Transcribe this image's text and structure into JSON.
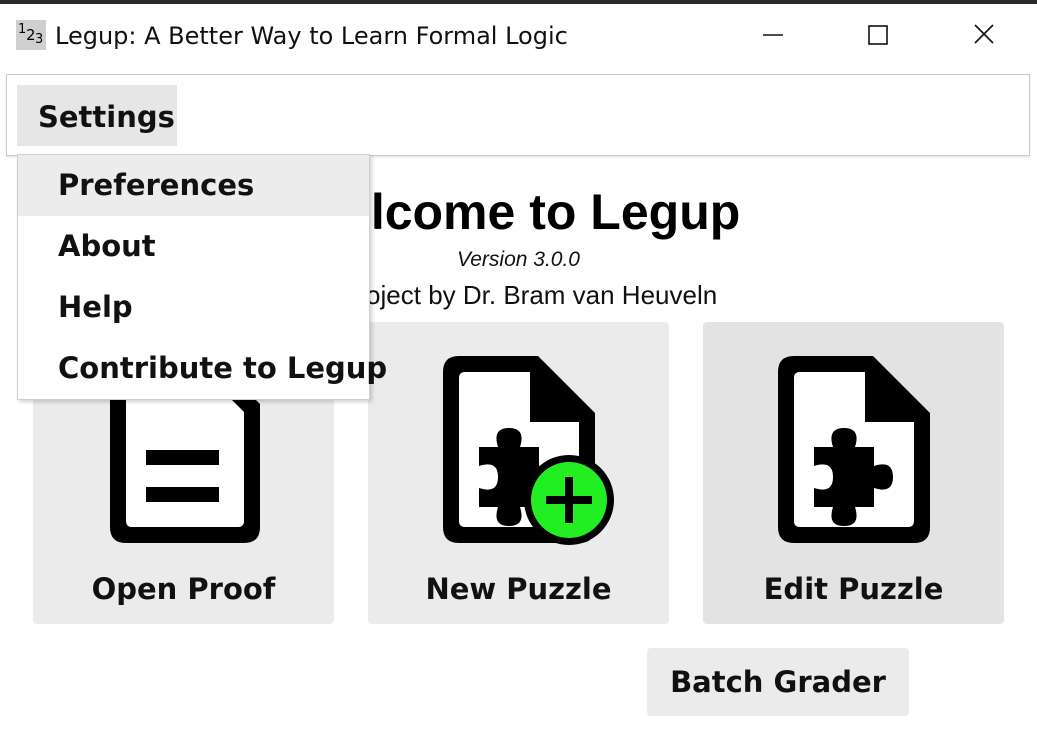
{
  "window": {
    "title": "Legup: A Better Way to Learn Formal Logic",
    "icon_digits": [
      "1",
      "2",
      "3"
    ],
    "minimize_icon": "minimize-icon",
    "maximize_icon": "maximize-icon",
    "close_icon": "close-icon"
  },
  "menubar": {
    "settings_label": "Settings"
  },
  "settings_menu": {
    "items": [
      {
        "label": "Preferences",
        "highlighted": true
      },
      {
        "label": "About"
      },
      {
        "label": "Help"
      },
      {
        "label": "Contribute to Legup"
      }
    ]
  },
  "welcome": {
    "title": "Welcome to Legup",
    "version": "Version 3.0.0",
    "project": "A project by Dr. Bram van Heuveln"
  },
  "actions": {
    "open_proof": {
      "label": "Open Proof",
      "icon": "document-icon"
    },
    "new_puzzle": {
      "label": "New Puzzle",
      "icon": "puzzle-file-add-icon"
    },
    "edit_puzzle": {
      "label": "Edit Puzzle",
      "icon": "puzzle-file-icon"
    },
    "batch_grader": {
      "label": "Batch Grader"
    }
  },
  "colors": {
    "button_bg": "#ebebeb",
    "menu_highlight": "#ececec",
    "plus_badge": "#22ee22"
  }
}
